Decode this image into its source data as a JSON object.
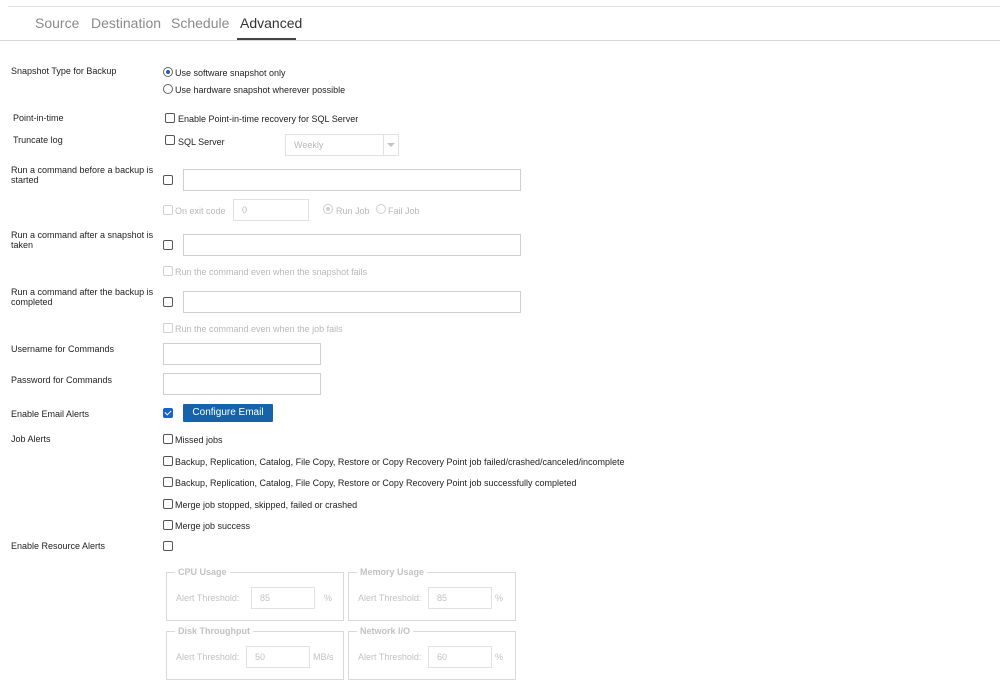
{
  "tabs": [
    {
      "label": "Source"
    },
    {
      "label": "Destination"
    },
    {
      "label": "Schedule"
    },
    {
      "label": "Advanced"
    }
  ],
  "snapshot": {
    "label": "Snapshot Type for Backup",
    "option_software": "Use software snapshot only",
    "option_hardware": "Use hardware snapshot wherever possible"
  },
  "point_in_time": {
    "label": "Point-in-time",
    "checkbox_label": "Enable Point-in-time recovery for SQL Server"
  },
  "truncate_log": {
    "label": "Truncate log",
    "checkbox_label": "SQL Server",
    "select_value": "Weekly"
  },
  "cmd_before": {
    "label": "Run a command before a backup is started",
    "exit_code_label": "On exit code",
    "exit_code_value": "0",
    "run_job_label": "Run Job",
    "fail_job_label": "Fail Job"
  },
  "cmd_after_snapshot": {
    "label": "Run a command after a snapshot is taken",
    "sub_label": "Run the command even when the snapshot fails"
  },
  "cmd_after_backup": {
    "label": "Run a command after the backup is completed",
    "sub_label": "Run the command even when the job fails"
  },
  "username": {
    "label": "Username for Commands"
  },
  "password": {
    "label": "Password for Commands"
  },
  "email_alerts": {
    "label": "Enable Email Alerts",
    "button": "Configure Email"
  },
  "job_alerts": {
    "label": "Job Alerts",
    "items": [
      "Missed jobs",
      "Backup, Replication, Catalog, File Copy, Restore or Copy Recovery Point job failed/crashed/canceled/incomplete",
      "Backup, Replication, Catalog, File Copy, Restore or Copy Recovery Point job successfully completed",
      "Merge job stopped, skipped, failed or crashed",
      "Merge job success"
    ]
  },
  "resource_alerts": {
    "label": "Enable Resource Alerts",
    "threshold_label": "Alert Threshold:",
    "groups": [
      {
        "title": "CPU Usage",
        "value": "85",
        "unit": "%"
      },
      {
        "title": "Memory Usage",
        "value": "85",
        "unit": "%"
      },
      {
        "title": "Disk Throughput",
        "value": "50",
        "unit": "MB/s"
      },
      {
        "title": "Network I/O",
        "value": "60",
        "unit": "%"
      }
    ]
  },
  "colors": {
    "accent": "#1463ab",
    "checkbox_checked": "#1a63c6",
    "disabled_text": "#b8b8b8"
  }
}
